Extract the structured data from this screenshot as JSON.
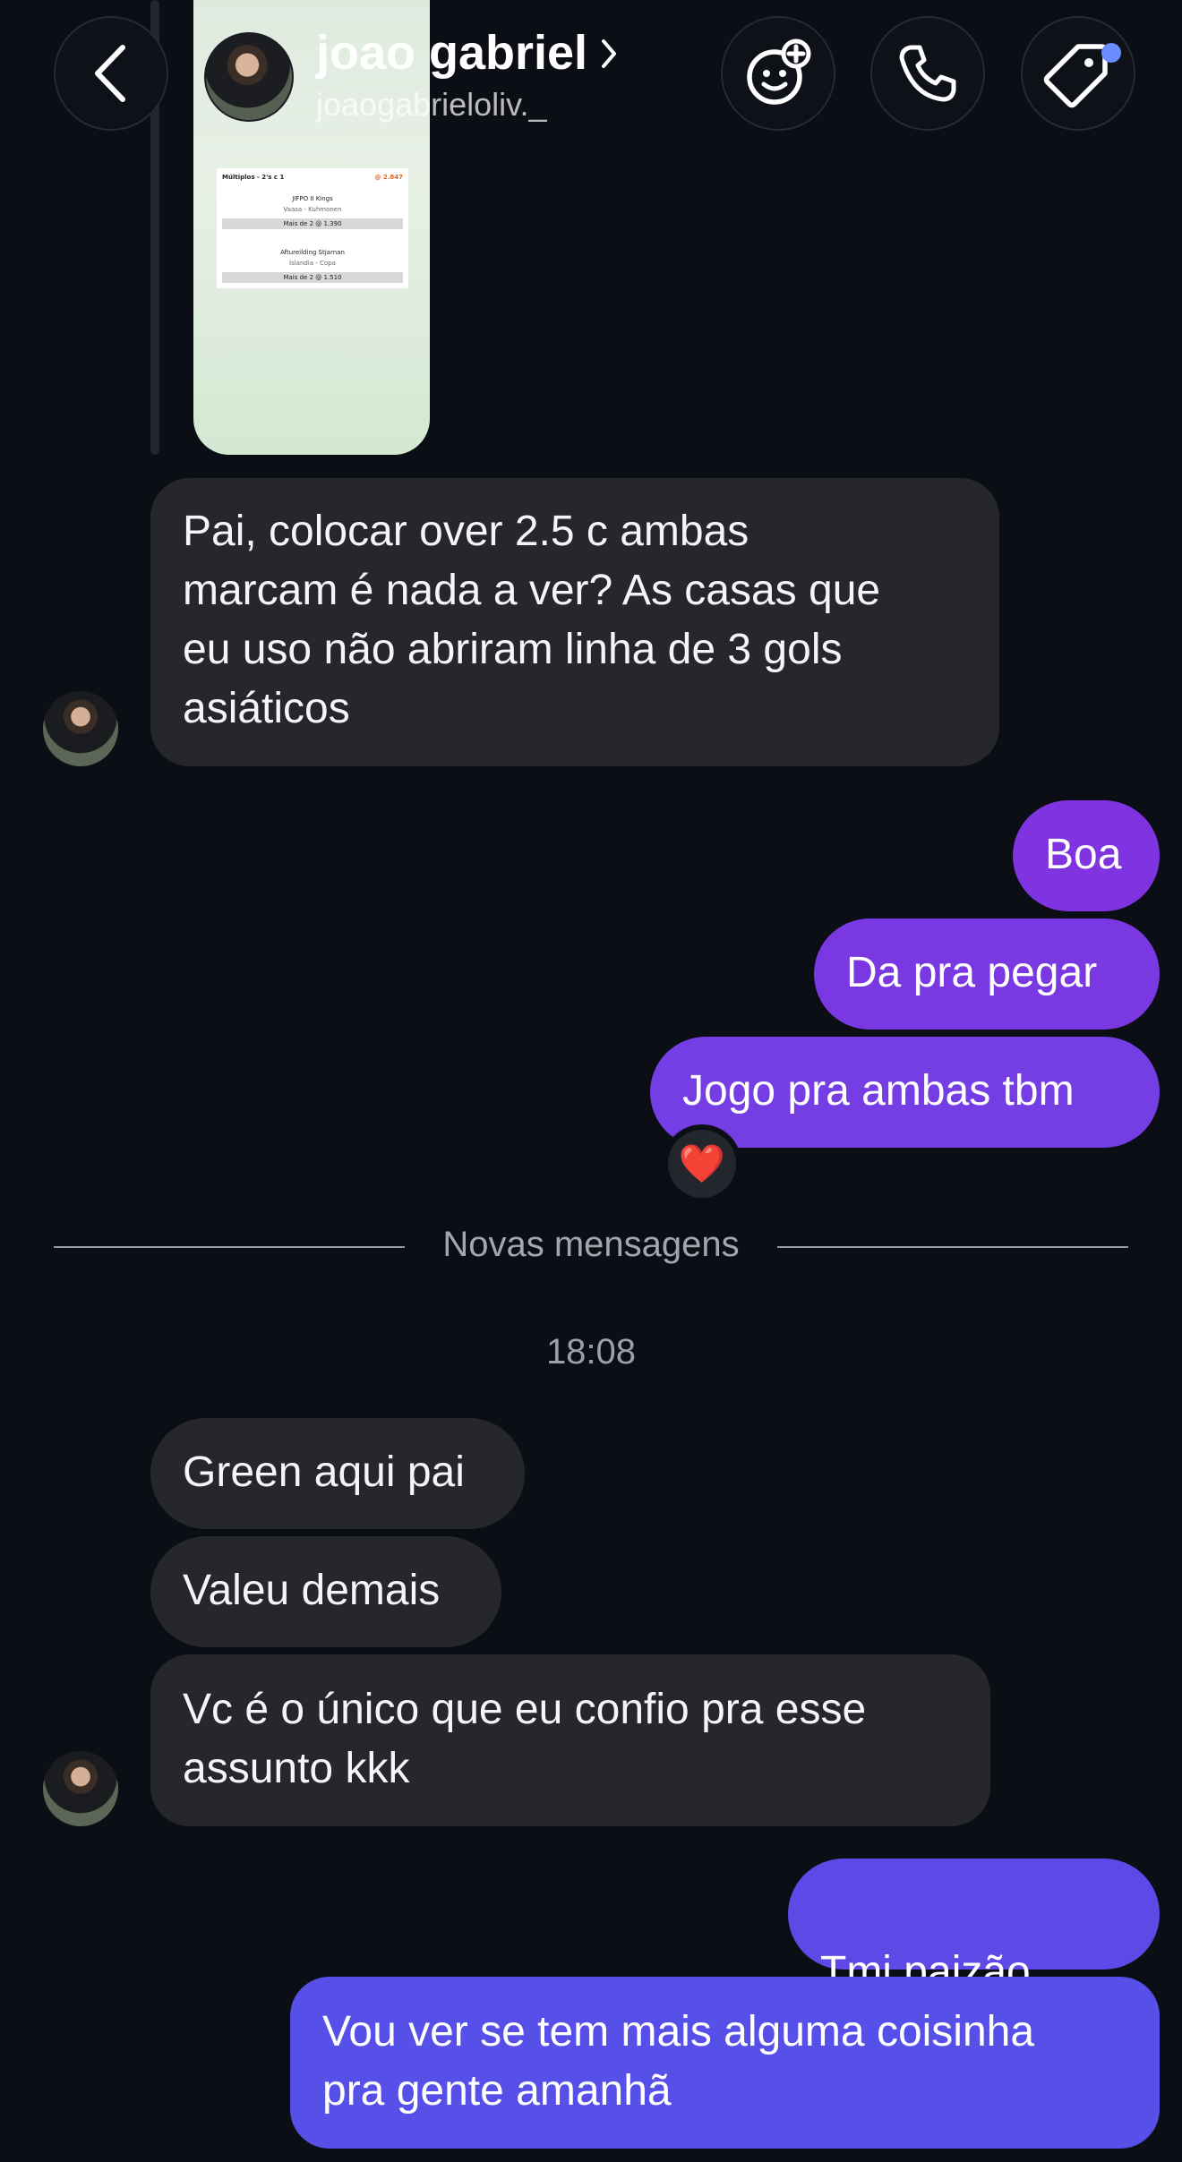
{
  "header": {
    "name": "joao gabriel",
    "handle": "joaogabrieloliv._",
    "icons": {
      "back": "chevron-left-icon",
      "avatar": "profile-photo",
      "effects": "sticker-plus-icon",
      "call": "phone-icon",
      "tag": "tag-icon"
    },
    "tag_badge_color": "#6b8cff"
  },
  "image_message": {
    "alt": "bet-slip-screenshot",
    "slip_lines": [
      "Múltiplos - 2's c 1",
      "@ 2.847",
      "JIFPO II Kings",
      "Vaasa - Kuhmonen",
      "Mais de 2 @ 1.390",
      "Aftureilding Stjarnan",
      "Íslandia - Copa",
      "Mais de 2 @ 1.510"
    ]
  },
  "messages": [
    {
      "side": "received",
      "text": "Pai, colocar over 2.5 c ambas\nmarcam é nada a ver? As casas que\neu uso não abriram linha de 3 gols\nasiáticos"
    },
    {
      "side": "sent",
      "text": "Boa"
    },
    {
      "side": "sent",
      "text": "Da pra pegar"
    },
    {
      "side": "sent",
      "text": "Jogo pra ambas tbm",
      "reaction": "❤️"
    },
    {
      "side": "received",
      "text": "Green aqui pai"
    },
    {
      "side": "received",
      "text": "Valeu demais"
    },
    {
      "side": "received",
      "text": "Vc é o único que eu confio pra esse\nassunto kkk"
    },
    {
      "side": "sent",
      "text": "Tmj paizão",
      "emoji": "💚"
    },
    {
      "side": "sent",
      "text": "Vou ver se tem mais alguma coisinha\npra gente amanhã"
    }
  ],
  "divider": {
    "label": "Novas mensagens"
  },
  "timestamp": "18:08",
  "colors": {
    "background": "#0b0e14",
    "received_bubble": "#25272c",
    "sent_purple": "#7b3fe0",
    "sent_indigo": "#5a4de8"
  }
}
